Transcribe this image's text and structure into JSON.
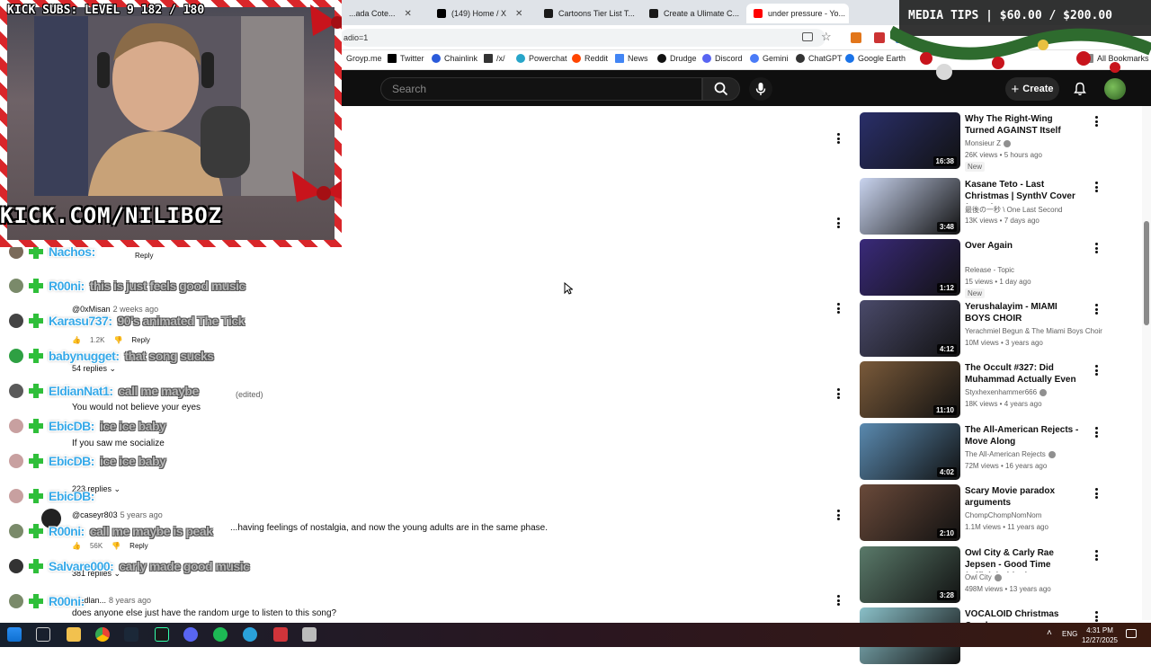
{
  "browser": {
    "tabs": [
      {
        "label": "...ada Cote..."
      },
      {
        "label": "(149) Home / X"
      },
      {
        "label": "Cartoons Tier List T..."
      },
      {
        "label": "Create a Ulimate C..."
      },
      {
        "label": "under pressure - Yo..."
      }
    ],
    "url": "adio=1",
    "bookmarks": [
      "Groyp.me",
      "Twitter",
      "Chainlink",
      "/x/",
      "Powerchat",
      "Reddit",
      "News",
      "Drudge",
      "Discord",
      "Gemini",
      "ChatGPT",
      "Google Earth"
    ],
    "all_bookmarks": "All Bookmarks"
  },
  "youtube": {
    "search_placeholder": "Search",
    "create_label": "Create"
  },
  "comments": [
    {
      "reply": "Reply"
    },
    {
      "author": "@0xMisan",
      "age": "2 weeks ago",
      "likes": "1.2K",
      "reply": "Reply",
      "replies": "54 replies"
    },
    {
      "suffix": "(edited)",
      "text": "You would not believe your eyes",
      "text2": "If you saw me socialize",
      "replies": "223 replies"
    },
    {
      "author": "@caseyr803",
      "age": "5 years ago",
      "text": "...having feelings of nostalgia, and now the young adults are in the same phase.",
      "likes": "56K",
      "reply": "Reply",
      "replies": "381 replies"
    },
    {
      "author": "...dlan...",
      "age": "8 years ago",
      "text": "does anyone else just have the random urge to listen to this song?"
    }
  ],
  "chat": [
    {
      "name": "Nachos:",
      "msg": "",
      "avatar_color": "#7a6a5a",
      "name_color": "#37a9e8"
    },
    {
      "name": "R00ni:",
      "msg": "this is just feels good music",
      "avatar_color": "#7a8a6a",
      "name_color": "#37a9e8"
    },
    {
      "name": "Karasu737:",
      "msg": "90's animated The Tick",
      "avatar_color": "#444444",
      "name_color": "#37a9e8"
    },
    {
      "name": "babynugget:",
      "msg": "that song sucks",
      "avatar_color": "#2ea043",
      "name_color": "#37a9e8"
    },
    {
      "name": "EldianNat1:",
      "msg": "call me maybe",
      "avatar_color": "#5a5a5a",
      "name_color": "#37a9e8"
    },
    {
      "name": "EbicDB:",
      "msg": "ice ice baby",
      "avatar_color": "#c8a0a0",
      "name_color": "#37a9e8"
    },
    {
      "name": "EbicDB:",
      "msg": "ice ice baby",
      "avatar_color": "#c8a0a0",
      "name_color": "#37a9e8"
    },
    {
      "name": "EbicDB:",
      "msg": "",
      "avatar_color": "#c8a0a0",
      "name_color": "#37a9e8"
    },
    {
      "name": "R00ni:",
      "msg": "call me maybe is peak",
      "avatar_color": "#7a8a6a",
      "name_color": "#37a9e8"
    },
    {
      "name": "Salvare000:",
      "msg": "carly made good music",
      "avatar_color": "#333333",
      "name_color": "#37a9e8"
    },
    {
      "name": "R00ni:",
      "msg": "",
      "avatar_color": "#7a8a6a",
      "name_color": "#37a9e8"
    }
  ],
  "recommendations": [
    {
      "title": "Why The Right-Wing Turned AGAINST Itself",
      "channel": "Monsieur Z",
      "verified": true,
      "stats": "26K views • 5 hours ago",
      "new": "New",
      "duration": "16:38",
      "thumb": "#2a2f6a"
    },
    {
      "title": "Kasane Teto - Last Christmas | SynthV Cover (+SVP)",
      "channel": "最後の一秒 \\ One Last Second",
      "verified": false,
      "stats": "13K views • 7 days ago",
      "new": "",
      "duration": "3:48",
      "thumb": "#c9d4ef"
    },
    {
      "title": "Over Again",
      "channel": "Release - Topic",
      "verified": false,
      "stats": "15 views • 1 day ago",
      "new": "New",
      "duration": "1:12",
      "thumb": "#3a2a7a"
    },
    {
      "title": "Yerushalayim - MIAMI BOYS CHOIR",
      "channel": "Yerachmiel Begun & The Miami Boys Choir",
      "verified": false,
      "stats": "10M views • 3 years ago",
      "new": "",
      "duration": "4:12",
      "thumb": "#4a4a6a"
    },
    {
      "title": "The Occult #327: Did Muhammad Actually Even ...",
      "channel": "Styxhexenhammer666",
      "verified": true,
      "stats": "18K views • 4 years ago",
      "new": "",
      "duration": "11:10",
      "thumb": "#7a5a3a"
    },
    {
      "title": "The All-American Rejects - Move Along",
      "channel": "The All-American Rejects",
      "verified": true,
      "stats": "72M views • 16 years ago",
      "new": "",
      "duration": "4:02",
      "thumb": "#5a8ab0"
    },
    {
      "title": "Scary Movie paradox arguments",
      "channel": "ChompChompNomNom",
      "verified": false,
      "stats": "1.1M views • 11 years ago",
      "new": "",
      "duration": "2:10",
      "thumb": "#6a4a3a"
    },
    {
      "title": "Owl City & Carly Rae Jepsen - Good Time (Official Video)",
      "channel": "Owl City",
      "verified": true,
      "stats": "498M views • 13 years ago",
      "new": "",
      "duration": "3:28",
      "thumb": "#5a7a6a"
    },
    {
      "title": "VOCALOID Christmas Carol ...",
      "channel": "",
      "verified": false,
      "stats": "",
      "new": "",
      "duration": "",
      "thumb": "#8ac0c8"
    }
  ],
  "overlay": {
    "kick_subs": "KICK SUBS: LEVEL 9 182 / 180",
    "kick_url": "KICK.COM/NILIBOZ",
    "media_tips": "MEDIA TIPS | $60.00 / $200.00"
  },
  "scroll_position": 0.28,
  "taskbar": {
    "lang": "ENG",
    "time": "4:31 PM",
    "date": "12/27/2025"
  }
}
